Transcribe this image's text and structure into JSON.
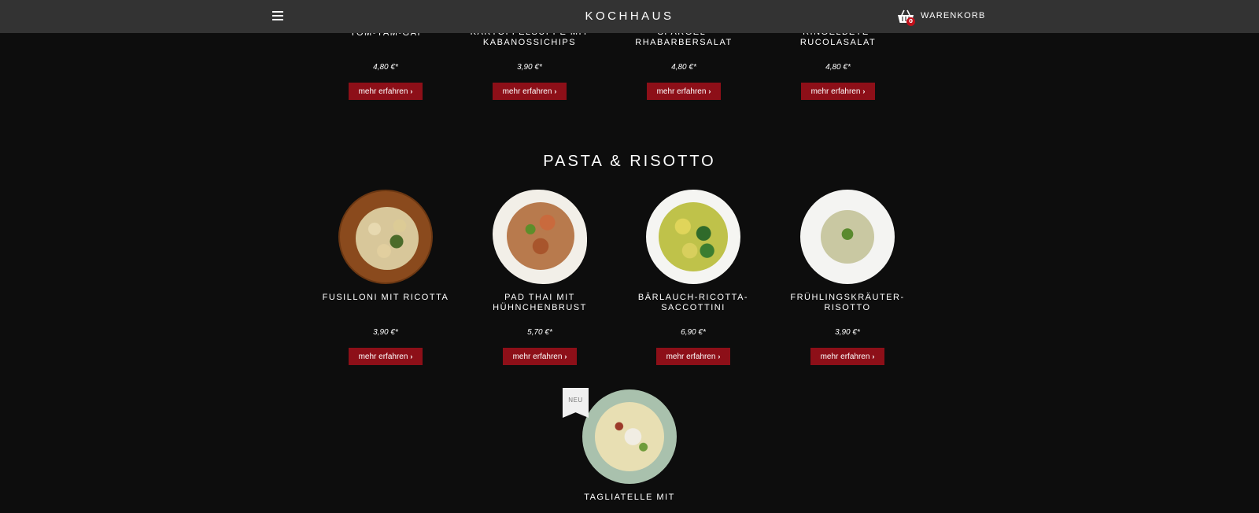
{
  "header": {
    "brand": "KOCHHAUS",
    "cart_label": "WARENKORB",
    "cart_count": "0",
    "menu_icon": "hamburger-icon",
    "cart_icon": "basket-icon"
  },
  "top_row": {
    "products": [
      {
        "name_partial": "TOM-YAM-GAI",
        "price": "4,80 €*",
        "button": "mehr erfahren"
      },
      {
        "name_partial": "KARTOFFELSUPPE MIT\nKABANOSSICHIPS",
        "price": "3,90 €*",
        "button": "mehr erfahren"
      },
      {
        "name_partial": "SPARGEL-\nRHABARBERSALAT",
        "price": "4,80 €*",
        "button": "mehr erfahren"
      },
      {
        "name_partial": "MOZZARELLA AUF\nRINGELBETE-\nRUCOLASALAT",
        "price": "4,80 €*",
        "button": "mehr erfahren"
      }
    ]
  },
  "section": {
    "title": "PASTA & RISOTTO",
    "products": [
      {
        "name": "FUSILLONI MIT RICOTTA",
        "price": "3,90 €*",
        "button": "mehr erfahren"
      },
      {
        "name": "PAD THAI MIT\nHÜHNCHENBRUST",
        "price": "5,70 €*",
        "button": "mehr erfahren"
      },
      {
        "name": "BÄRLAUCH-RICOTTA-\nSACCOTTINI",
        "price": "6,90 €*",
        "button": "mehr erfahren"
      },
      {
        "name": "FRÜHLINGSKRÄUTER-\nRISOTTO",
        "price": "3,90 €*",
        "button": "mehr erfahren"
      }
    ],
    "new_product": {
      "badge": "NEU",
      "name_partial": "TAGLIATELLE MIT"
    }
  },
  "colors": {
    "background": "#0d0d0d",
    "topbar": "#333333",
    "button": "#8d0f18",
    "badge": "#c0101a"
  }
}
